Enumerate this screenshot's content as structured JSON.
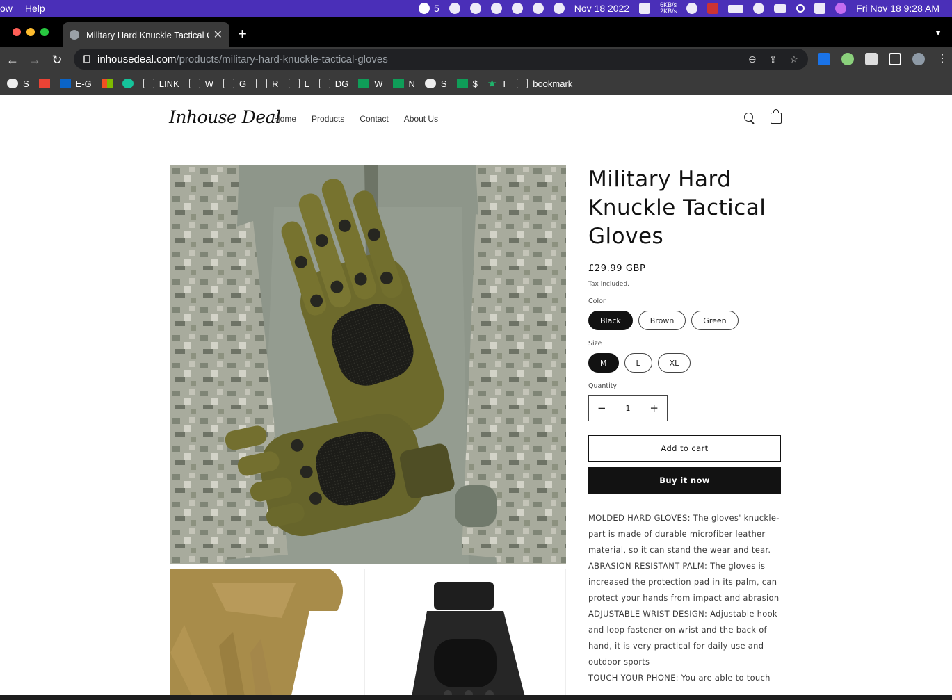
{
  "menubar": {
    "app_menu": "ow",
    "help": "Help",
    "wechat_count": "5",
    "date_short": "Nov 18 2022",
    "net_up": "6KB/s",
    "net_down": "2KB/s",
    "datetime": "Fri Nov 18  9:28 AM"
  },
  "browser": {
    "tab_title": "Military Hard Knuckle Tactical Gloves",
    "url_host": "inhousedeal.com",
    "url_path": "/products/military-hard-knuckle-tactical-gloves",
    "bookmarks": [
      {
        "label": "S",
        "icon": "globe-icon"
      },
      {
        "label": "",
        "icon": "gmail-icon"
      },
      {
        "label": "E-G",
        "icon": "outlook-icon"
      },
      {
        "label": "",
        "icon": "microsoft-icon"
      },
      {
        "label": "",
        "icon": "grammarly-icon"
      },
      {
        "label": "LINK",
        "icon": "folder-icon"
      },
      {
        "label": "W",
        "icon": "folder-icon"
      },
      {
        "label": "G",
        "icon": "folder-icon"
      },
      {
        "label": "R",
        "icon": "folder-icon"
      },
      {
        "label": "L",
        "icon": "folder-icon"
      },
      {
        "label": "DG",
        "icon": "folder-icon"
      },
      {
        "label": "W",
        "icon": "sheets-icon"
      },
      {
        "label": "N",
        "icon": "sheets-icon"
      },
      {
        "label": "S",
        "icon": "globe-icon"
      },
      {
        "label": "$",
        "icon": "sheets-icon"
      },
      {
        "label": "T",
        "icon": "star-icon"
      },
      {
        "label": "bookmark",
        "icon": "folder-icon"
      }
    ]
  },
  "site": {
    "logo": "Inhouse Deal",
    "nav": [
      "Home",
      "Products",
      "Contact",
      "About Us"
    ]
  },
  "product": {
    "title": "Military Hard Knuckle Tactical Gloves",
    "price": "£29.99 GBP",
    "tax_note": "Tax included.",
    "color_label": "Color",
    "colors": [
      "Black",
      "Brown",
      "Green"
    ],
    "selected_color": "Black",
    "size_label": "Size",
    "sizes": [
      "M",
      "L",
      "XL"
    ],
    "selected_size": "M",
    "quantity_label": "Quantity",
    "quantity": "1",
    "add_to_cart": "Add to cart",
    "buy_now": "Buy it now",
    "description": [
      "MOLDED HARD GLOVES: The gloves' knuckle-part is made of durable microfiber leather material, so it can stand the wear and tear.",
      "ABRASION RESISTANT PALM: The gloves is increased the protection pad in its palm, can protect your hands from impact and abrasion",
      "ADJUSTABLE WRIST DESIGN: Adjustable hook and loop fastener on wrist and the back of hand, it is very practical for daily use and outdoor sports",
      "TOUCH YOUR PHONE: You are able to touch"
    ]
  },
  "colors": {
    "menubar": "#4a2fb8",
    "browser_chrome": "#3a3a3a",
    "accent_dark": "#121212"
  }
}
